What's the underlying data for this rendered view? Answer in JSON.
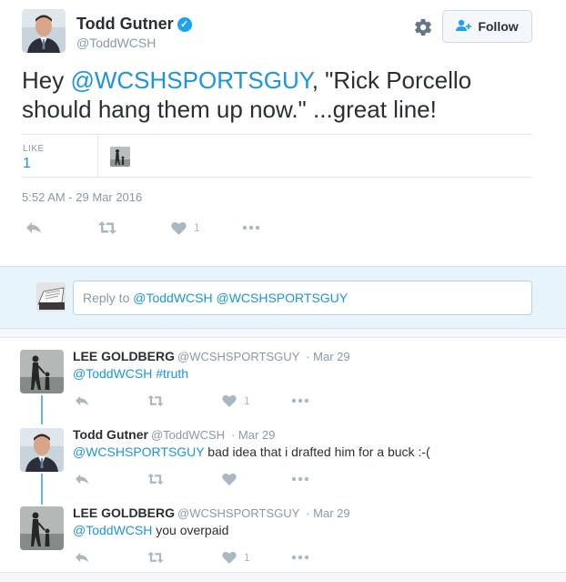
{
  "author": {
    "name": "Todd Gutner",
    "handle": "@ToddWCSH",
    "verified_icon": "verified-badge-icon"
  },
  "header": {
    "follow_label": "Follow",
    "follow_icon": "add-user-icon",
    "settings_icon": "gear-icon"
  },
  "tweet": {
    "text_prefix": "Hey ",
    "mention": "@WCSHSPORTSGUY",
    "text_suffix": ", \"Rick Porcello should hang them up now.\" ...great line!",
    "like_label": "LIKE",
    "like_count": "1",
    "timestamp": "5:52 AM - 29 Mar 2016",
    "actions": {
      "like_count": "1"
    }
  },
  "reply_box": {
    "placeholder_prefix": "Reply to ",
    "mentions": "@ToddWCSH @WCSHSPORTSGUY"
  },
  "replies": [
    {
      "name": "LEE GOLDBERG",
      "handle": "@WCSHSPORTSGUY",
      "date": "· Mar 29",
      "mention": "@ToddWCSH",
      "text": " #truth",
      "text_is_link": true,
      "like_count": "1"
    },
    {
      "name": "Todd Gutner",
      "handle": "@ToddWCSH",
      "date": "· Mar 29",
      "mention": "@WCSHSPORTSGUY",
      "text": " bad idea that i drafted him for a buck :-(",
      "text_is_link": false,
      "like_count": ""
    },
    {
      "name": "LEE GOLDBERG",
      "handle": "@WCSHSPORTSGUY",
      "date": "· Mar 29",
      "mention": "@ToddWCSH",
      "text": " you overpaid",
      "text_is_link": false,
      "like_count": "1"
    }
  ],
  "colors": {
    "accent": "#1b95e0",
    "muted": "#8899a6",
    "thread_line": "#61b8df",
    "reply_bar_bg": "#e8f4fb"
  }
}
